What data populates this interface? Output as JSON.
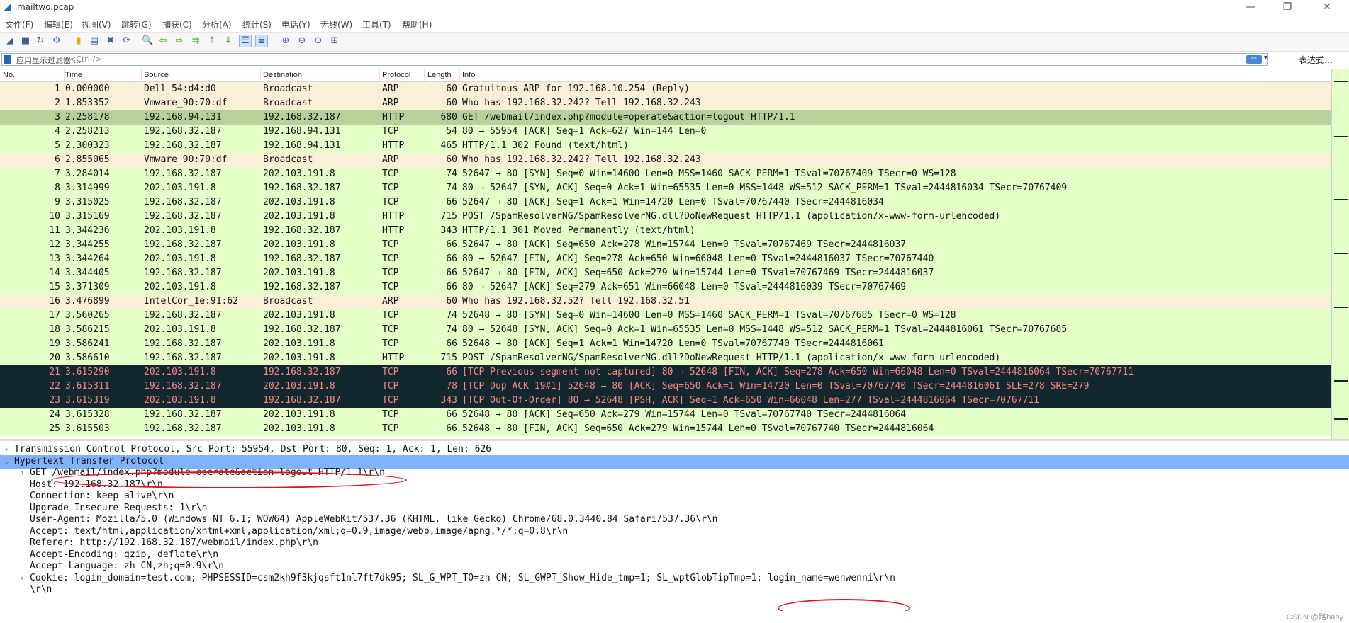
{
  "window": {
    "title": "mailtwo.pcap",
    "minimize_glyph": "—",
    "restore_glyph": "❐",
    "close_glyph": "✕"
  },
  "menu": [
    "文件(F)",
    "编辑(E)",
    "视图(V)",
    "跳转(G)",
    "捕获(C)",
    "分析(A)",
    "统计(S)",
    "电话(Y)",
    "无线(W)",
    "工具(T)",
    "帮助(H)"
  ],
  "toolbar_icons": [
    {
      "name": "shark-fin-start-icon",
      "glyph": "◢"
    },
    {
      "name": "stop-capture-icon",
      "glyph": "■"
    },
    {
      "name": "restart-capture-icon",
      "glyph": "↻"
    },
    {
      "name": "capture-options-icon",
      "glyph": "⚙"
    },
    {
      "name": "open-file-icon",
      "glyph": "▮"
    },
    {
      "name": "save-file-icon",
      "glyph": "▤"
    },
    {
      "name": "close-file-icon",
      "glyph": "✖"
    },
    {
      "name": "reload-file-icon",
      "glyph": "⟳"
    },
    {
      "name": "find-packet-icon",
      "glyph": "🔍"
    },
    {
      "name": "go-back-icon",
      "glyph": "⇦"
    },
    {
      "name": "go-forward-icon",
      "glyph": "⇨"
    },
    {
      "name": "go-to-packet-icon",
      "glyph": "⇉"
    },
    {
      "name": "first-packet-icon",
      "glyph": "⇑"
    },
    {
      "name": "last-packet-icon",
      "glyph": "⇓"
    },
    {
      "name": "autoscroll-icon",
      "glyph": "☰"
    },
    {
      "name": "colorize-icon",
      "glyph": "≣"
    },
    {
      "name": "zoom-in-icon",
      "glyph": "⊕"
    },
    {
      "name": "zoom-out-icon",
      "glyph": "⊖"
    },
    {
      "name": "zoom-reset-icon",
      "glyph": "⊙"
    },
    {
      "name": "resize-columns-icon",
      "glyph": "⊞"
    }
  ],
  "filter": {
    "label": "应用显示过滤器 …",
    "placeholder": "<Ctrl-/>",
    "apply_glyph": "⇨",
    "dropdown_glyph": "▾",
    "expression_label": "表达式…"
  },
  "packet_list": {
    "headers": {
      "no": "No.",
      "time": "Time",
      "source": "Source",
      "destination": "Destination",
      "protocol": "Protocol",
      "length": "Length",
      "info": "Info"
    },
    "colors": {
      "arp_bg": "#faf0d7",
      "tcp_bg": "#e4ffc7",
      "selected_bg": "#b7d19a",
      "bad_bg": "#12272e",
      "bad_fg": "#f78787"
    },
    "rows": [
      {
        "no": "1",
        "time": "0.000000",
        "source": "Dell_54:d4:d0",
        "destination": "Broadcast",
        "protocol": "ARP",
        "length": "60",
        "info": "Gratuitous ARP for 192.168.10.254 (Reply)",
        "kind": "arp"
      },
      {
        "no": "2",
        "time": "1.853352",
        "source": "Vmware_90:70:df",
        "destination": "Broadcast",
        "protocol": "ARP",
        "length": "60",
        "info": "Who has 192.168.32.242? Tell 192.168.32.243",
        "kind": "arp"
      },
      {
        "no": "3",
        "time": "2.258178",
        "source": "192.168.94.131",
        "destination": "192.168.32.187",
        "protocol": "HTTP",
        "length": "680",
        "info": "GET /webmail/index.php?module=operate&action=logout HTTP/1.1",
        "kind": "selected"
      },
      {
        "no": "4",
        "time": "2.258213",
        "source": "192.168.32.187",
        "destination": "192.168.94.131",
        "protocol": "TCP",
        "length": "54",
        "info": "80 → 55954 [ACK] Seq=1 Ack=627 Win=144 Len=0",
        "kind": "tcp"
      },
      {
        "no": "5",
        "time": "2.300323",
        "source": "192.168.32.187",
        "destination": "192.168.94.131",
        "protocol": "HTTP",
        "length": "465",
        "info": "HTTP/1.1 302 Found  (text/html)",
        "kind": "tcp"
      },
      {
        "no": "6",
        "time": "2.855065",
        "source": "Vmware_90:70:df",
        "destination": "Broadcast",
        "protocol": "ARP",
        "length": "60",
        "info": "Who has 192.168.32.242? Tell 192.168.32.243",
        "kind": "arp"
      },
      {
        "no": "7",
        "time": "3.284014",
        "source": "192.168.32.187",
        "destination": "202.103.191.8",
        "protocol": "TCP",
        "length": "74",
        "info": "52647 → 80 [SYN] Seq=0 Win=14600 Len=0 MSS=1460 SACK_PERM=1 TSval=70767409 TSecr=0 WS=128",
        "kind": "tcp"
      },
      {
        "no": "8",
        "time": "3.314999",
        "source": "202.103.191.8",
        "destination": "192.168.32.187",
        "protocol": "TCP",
        "length": "74",
        "info": "80 → 52647 [SYN, ACK] Seq=0 Ack=1 Win=65535 Len=0 MSS=1448 WS=512 SACK_PERM=1 TSval=2444816034 TSecr=70767409",
        "kind": "tcp"
      },
      {
        "no": "9",
        "time": "3.315025",
        "source": "192.168.32.187",
        "destination": "202.103.191.8",
        "protocol": "TCP",
        "length": "66",
        "info": "52647 → 80 [ACK] Seq=1 Ack=1 Win=14720 Len=0 TSval=70767440 TSecr=2444816034",
        "kind": "tcp"
      },
      {
        "no": "10",
        "time": "3.315169",
        "source": "192.168.32.187",
        "destination": "202.103.191.8",
        "protocol": "HTTP",
        "length": "715",
        "info": "POST /SpamResolverNG/SpamResolverNG.dll?DoNewRequest HTTP/1.1  (application/x-www-form-urlencoded)",
        "kind": "tcp"
      },
      {
        "no": "11",
        "time": "3.344236",
        "source": "202.103.191.8",
        "destination": "192.168.32.187",
        "protocol": "HTTP",
        "length": "343",
        "info": "HTTP/1.1 301 Moved Permanently  (text/html)",
        "kind": "tcp"
      },
      {
        "no": "12",
        "time": "3.344255",
        "source": "192.168.32.187",
        "destination": "202.103.191.8",
        "protocol": "TCP",
        "length": "66",
        "info": "52647 → 80 [ACK] Seq=650 Ack=278 Win=15744 Len=0 TSval=70767469 TSecr=2444816037",
        "kind": "tcp"
      },
      {
        "no": "13",
        "time": "3.344264",
        "source": "202.103.191.8",
        "destination": "192.168.32.187",
        "protocol": "TCP",
        "length": "66",
        "info": "80 → 52647 [FIN, ACK] Seq=278 Ack=650 Win=66048 Len=0 TSval=2444816037 TSecr=70767440",
        "kind": "tcp"
      },
      {
        "no": "14",
        "time": "3.344405",
        "source": "192.168.32.187",
        "destination": "202.103.191.8",
        "protocol": "TCP",
        "length": "66",
        "info": "52647 → 80 [FIN, ACK] Seq=650 Ack=279 Win=15744 Len=0 TSval=70767469 TSecr=2444816037",
        "kind": "tcp"
      },
      {
        "no": "15",
        "time": "3.371309",
        "source": "202.103.191.8",
        "destination": "192.168.32.187",
        "protocol": "TCP",
        "length": "66",
        "info": "80 → 52647 [ACK] Seq=279 Ack=651 Win=66048 Len=0 TSval=2444816039 TSecr=70767469",
        "kind": "tcp"
      },
      {
        "no": "16",
        "time": "3.476899",
        "source": "IntelCor_1e:91:62",
        "destination": "Broadcast",
        "protocol": "ARP",
        "length": "60",
        "info": "Who has 192.168.32.52? Tell 192.168.32.51",
        "kind": "arp"
      },
      {
        "no": "17",
        "time": "3.560265",
        "source": "192.168.32.187",
        "destination": "202.103.191.8",
        "protocol": "TCP",
        "length": "74",
        "info": "52648 → 80 [SYN] Seq=0 Win=14600 Len=0 MSS=1460 SACK_PERM=1 TSval=70767685 TSecr=0 WS=128",
        "kind": "tcp"
      },
      {
        "no": "18",
        "time": "3.586215",
        "source": "202.103.191.8",
        "destination": "192.168.32.187",
        "protocol": "TCP",
        "length": "74",
        "info": "80 → 52648 [SYN, ACK] Seq=0 Ack=1 Win=65535 Len=0 MSS=1448 WS=512 SACK_PERM=1 TSval=2444816061 TSecr=70767685",
        "kind": "tcp"
      },
      {
        "no": "19",
        "time": "3.586241",
        "source": "192.168.32.187",
        "destination": "202.103.191.8",
        "protocol": "TCP",
        "length": "66",
        "info": "52648 → 80 [ACK] Seq=1 Ack=1 Win=14720 Len=0 TSval=70767740 TSecr=2444816061",
        "kind": "tcp"
      },
      {
        "no": "20",
        "time": "3.586610",
        "source": "192.168.32.187",
        "destination": "202.103.191.8",
        "protocol": "HTTP",
        "length": "715",
        "info": "POST /SpamResolverNG/SpamResolverNG.dll?DoNewRequest HTTP/1.1  (application/x-www-form-urlencoded)",
        "kind": "tcp"
      },
      {
        "no": "21",
        "time": "3.615290",
        "source": "202.103.191.8",
        "destination": "192.168.32.187",
        "protocol": "TCP",
        "length": "66",
        "info": "[TCP Previous segment not captured] 80 → 52648 [FIN, ACK] Seq=278 Ack=650 Win=66048 Len=0 TSval=2444816064 TSecr=70767711",
        "kind": "bad"
      },
      {
        "no": "22",
        "time": "3.615311",
        "source": "192.168.32.187",
        "destination": "202.103.191.8",
        "protocol": "TCP",
        "length": "78",
        "info": "[TCP Dup ACK 19#1] 52648 → 80 [ACK] Seq=650 Ack=1 Win=14720 Len=0 TSval=70767740 TSecr=2444816061 SLE=278 SRE=279",
        "kind": "bad"
      },
      {
        "no": "23",
        "time": "3.615319",
        "source": "202.103.191.8",
        "destination": "192.168.32.187",
        "protocol": "TCP",
        "length": "343",
        "info": "[TCP Out-Of-Order] 80 → 52648 [PSH, ACK] Seq=1 Ack=650 Win=66048 Len=277 TSval=2444816064 TSecr=70767711",
        "kind": "bad"
      },
      {
        "no": "24",
        "time": "3.615328",
        "source": "192.168.32.187",
        "destination": "202.103.191.8",
        "protocol": "TCP",
        "length": "66",
        "info": "52648 → 80 [ACK] Seq=650 Ack=279 Win=15744 Len=0 TSval=70767740 TSecr=2444816064",
        "kind": "tcp"
      },
      {
        "no": "25",
        "time": "3.615503",
        "source": "192.168.32.187",
        "destination": "202.103.191.8",
        "protocol": "TCP",
        "length": "66",
        "info": "52648 → 80 [FIN, ACK] Seq=650 Ack=279 Win=15744 Len=0 TSval=70767740 TSecr=2444816064",
        "kind": "tcp"
      }
    ]
  },
  "details": [
    {
      "toggle": "›",
      "text": "Transmission Control Protocol, Src Port: 55954, Dst Port: 80, Seq: 1, Ack: 1, Len: 626",
      "level": 0,
      "highlight": false
    },
    {
      "toggle": "⌄",
      "text": "Hypertext Transfer Protocol",
      "level": 0,
      "highlight": true
    },
    {
      "toggle": "›",
      "text": "GET /webmail/index.php?module=operate&action=logout HTTP/1.1\\r\\n",
      "level": 1,
      "highlight": false
    },
    {
      "toggle": "",
      "text": "Host: 192.168.32.187\\r\\n",
      "level": 1,
      "highlight": false
    },
    {
      "toggle": "",
      "text": "Connection: keep-alive\\r\\n",
      "level": 1,
      "highlight": false
    },
    {
      "toggle": "",
      "text": "Upgrade-Insecure-Requests: 1\\r\\n",
      "level": 1,
      "highlight": false
    },
    {
      "toggle": "",
      "text": "User-Agent: Mozilla/5.0 (Windows NT 6.1; WOW64) AppleWebKit/537.36 (KHTML, like Gecko) Chrome/68.0.3440.84 Safari/537.36\\r\\n",
      "level": 1,
      "highlight": false
    },
    {
      "toggle": "",
      "text": "Accept: text/html,application/xhtml+xml,application/xml;q=0.9,image/webp,image/apng,*/*;q=0.8\\r\\n",
      "level": 1,
      "highlight": false
    },
    {
      "toggle": "",
      "text": "Referer: http://192.168.32.187/webmail/index.php\\r\\n",
      "level": 1,
      "highlight": false
    },
    {
      "toggle": "",
      "text": "Accept-Encoding: gzip, deflate\\r\\n",
      "level": 1,
      "highlight": false
    },
    {
      "toggle": "",
      "text": "Accept-Language: zh-CN,zh;q=0.9\\r\\n",
      "level": 1,
      "highlight": false
    },
    {
      "toggle": "›",
      "text": "Cookie: login_domain=test.com; PHPSESSID=csm2kh9f3kjqsft1nl7ft7dk95; SL_G_WPT_TO=zh-CN; SL_GWPT_Show_Hide_tmp=1; SL_wptGlobTipTmp=1; login_name=wenwenni\\r\\n",
      "level": 1,
      "highlight": false
    },
    {
      "toggle": "",
      "text": "\\r\\n",
      "level": 1,
      "highlight": false
    }
  ],
  "annotation_color": "#e0141e",
  "watermark": "CSDN @路baby"
}
